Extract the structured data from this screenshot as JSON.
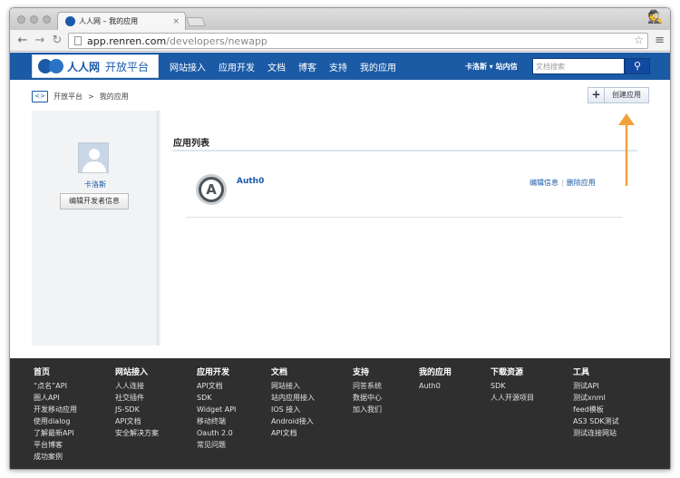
{
  "browser": {
    "tab_title": "人人网 – 我的应用",
    "tab_close": "×",
    "url_host": "app.renren.com",
    "url_path": "/developers/newapp",
    "menu": "≡"
  },
  "nav": {
    "logo_name": "人人网",
    "logo_sub": "开放平台",
    "links": [
      "网站接入",
      "应用开发",
      "文档",
      "博客",
      "支持",
      "我的应用"
    ],
    "user": "卡洛斯 ▾ 站内信",
    "search_placeholder": "文档搜索"
  },
  "breadcrumb": {
    "icon": "<>",
    "root": "开放平台",
    "sep": ">",
    "current": "我的应用"
  },
  "create_button": {
    "plus": "+",
    "label": "创建应用"
  },
  "sidebar": {
    "name": "卡洛斯",
    "edit": "编辑开发者信息"
  },
  "main": {
    "title": "应用列表",
    "app": {
      "name": "Auth0",
      "logo_letter": "A",
      "edit": "编辑信息",
      "delete": "删除应用"
    }
  },
  "footer": {
    "c0": {
      "title": "首页",
      "links": [
        "“点名”API",
        "圈人API",
        "开发移动应用",
        "使用dialog",
        "了解最新API",
        "平台博客",
        "成功案例"
      ]
    },
    "c1": {
      "title": "网站接入",
      "links": [
        "人人连接",
        "社交插件",
        "JS-SDK",
        "API文档",
        "安全解决方案"
      ]
    },
    "c2": {
      "title": "应用开发",
      "links": [
        "API文档",
        "SDK",
        "Widget API",
        "移动终端",
        "Oauth 2.0",
        "常见问题"
      ]
    },
    "c3": {
      "title": "文档",
      "links": [
        "网站接入",
        "站内应用接入",
        "IOS 接入",
        "Android接入",
        "API文档"
      ]
    },
    "c4": {
      "title": "支持",
      "links": [
        "问答系统",
        "数据中心",
        "加入我们"
      ]
    },
    "c5": {
      "title": "我的应用",
      "links": [
        "Auth0"
      ]
    },
    "c6": {
      "title": "下载资源",
      "links": [
        "SDK",
        "人人开源项目"
      ]
    },
    "c7": {
      "title": "工具",
      "links": [
        "测试API",
        "测试xnml",
        "feed模板",
        "AS3 SDK测试",
        "测试连接网站"
      ]
    }
  },
  "colors": {
    "brand": "#1b5aa5",
    "arrow": "#f0a33a",
    "footer_bg": "#2f2f2f"
  }
}
